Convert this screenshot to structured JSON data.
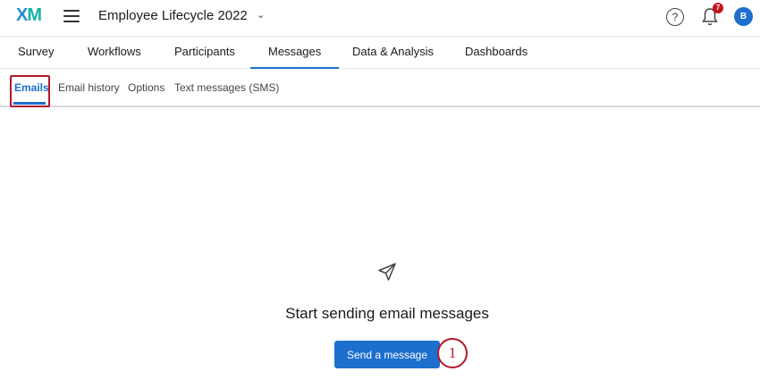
{
  "brand": {
    "logo_x": "X",
    "logo_m": "M"
  },
  "header": {
    "project_title": "Employee Lifecycle 2022",
    "help_glyph": "?",
    "notification_count": "7",
    "avatar_initial": "B"
  },
  "nav": {
    "tabs": [
      {
        "label": "Survey"
      },
      {
        "label": "Workflows"
      },
      {
        "label": "Participants"
      },
      {
        "label": "Messages",
        "active": true
      },
      {
        "label": "Data & Analysis"
      },
      {
        "label": "Dashboards"
      }
    ]
  },
  "subnav": {
    "tabs": [
      {
        "label": "Emails",
        "active": true
      },
      {
        "label": "Email history"
      },
      {
        "label": "Options"
      },
      {
        "label": "Text messages (SMS)"
      }
    ]
  },
  "empty_state": {
    "icon": "paper-plane-icon",
    "title": "Start sending email messages",
    "button_label": "Send a message"
  },
  "annotation": {
    "step_number": "1"
  },
  "colors": {
    "accent": "#1d6fce",
    "highlight": "#b2182b",
    "badge": "#c4161c"
  }
}
